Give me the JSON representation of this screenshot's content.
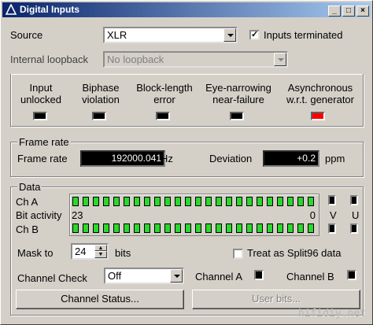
{
  "window": {
    "title": "Digital Inputs"
  },
  "titlebar_buttons": [
    "_",
    "□",
    "×"
  ],
  "source": {
    "label": "Source",
    "value": "XLR",
    "terminated_label": "Inputs terminated",
    "terminated_checked": true
  },
  "loopback": {
    "label": "Internal loopback",
    "value": "No loopback"
  },
  "status": [
    {
      "line1": "Input",
      "line2": "unlocked",
      "color": "#000000"
    },
    {
      "line1": "Biphase",
      "line2": "violation",
      "color": "#000000"
    },
    {
      "line1": "Block-length",
      "line2": "error",
      "color": "#000000"
    },
    {
      "line1": "Eye-narrowing",
      "line2": "near-failure",
      "color": "#000000"
    },
    {
      "line1": "Asynchronous",
      "line2": "w.r.t. generator",
      "color": "#ff0000"
    }
  ],
  "frame_rate": {
    "group_title": "Frame rate",
    "label": "Frame rate",
    "value": "192000.041",
    "unit": "Hz",
    "deviation_label": "Deviation",
    "deviation_value": "+0.2",
    "deviation_unit": "ppm"
  },
  "data": {
    "group_title": "Data",
    "ch_a": "Ch A",
    "bit_activity": "Bit activity",
    "ch_b": "Ch B",
    "bit_high": "23",
    "bit_low": "0",
    "v_label": "V",
    "u_label": "U",
    "bit_count": 24,
    "led_color": "#2dd72d"
  },
  "mask": {
    "label": "Mask to",
    "value": "24",
    "unit": "bits",
    "split96_label": "Treat as Split96 data",
    "split96_checked": false
  },
  "channel_check": {
    "label": "Channel Check",
    "value": "Off",
    "channel_a": "Channel A",
    "channel_b": "Channel B"
  },
  "buttons": {
    "channel_status": "Channel Status...",
    "user_bits": "User bits..."
  },
  "watermark": "hifidiy.net"
}
